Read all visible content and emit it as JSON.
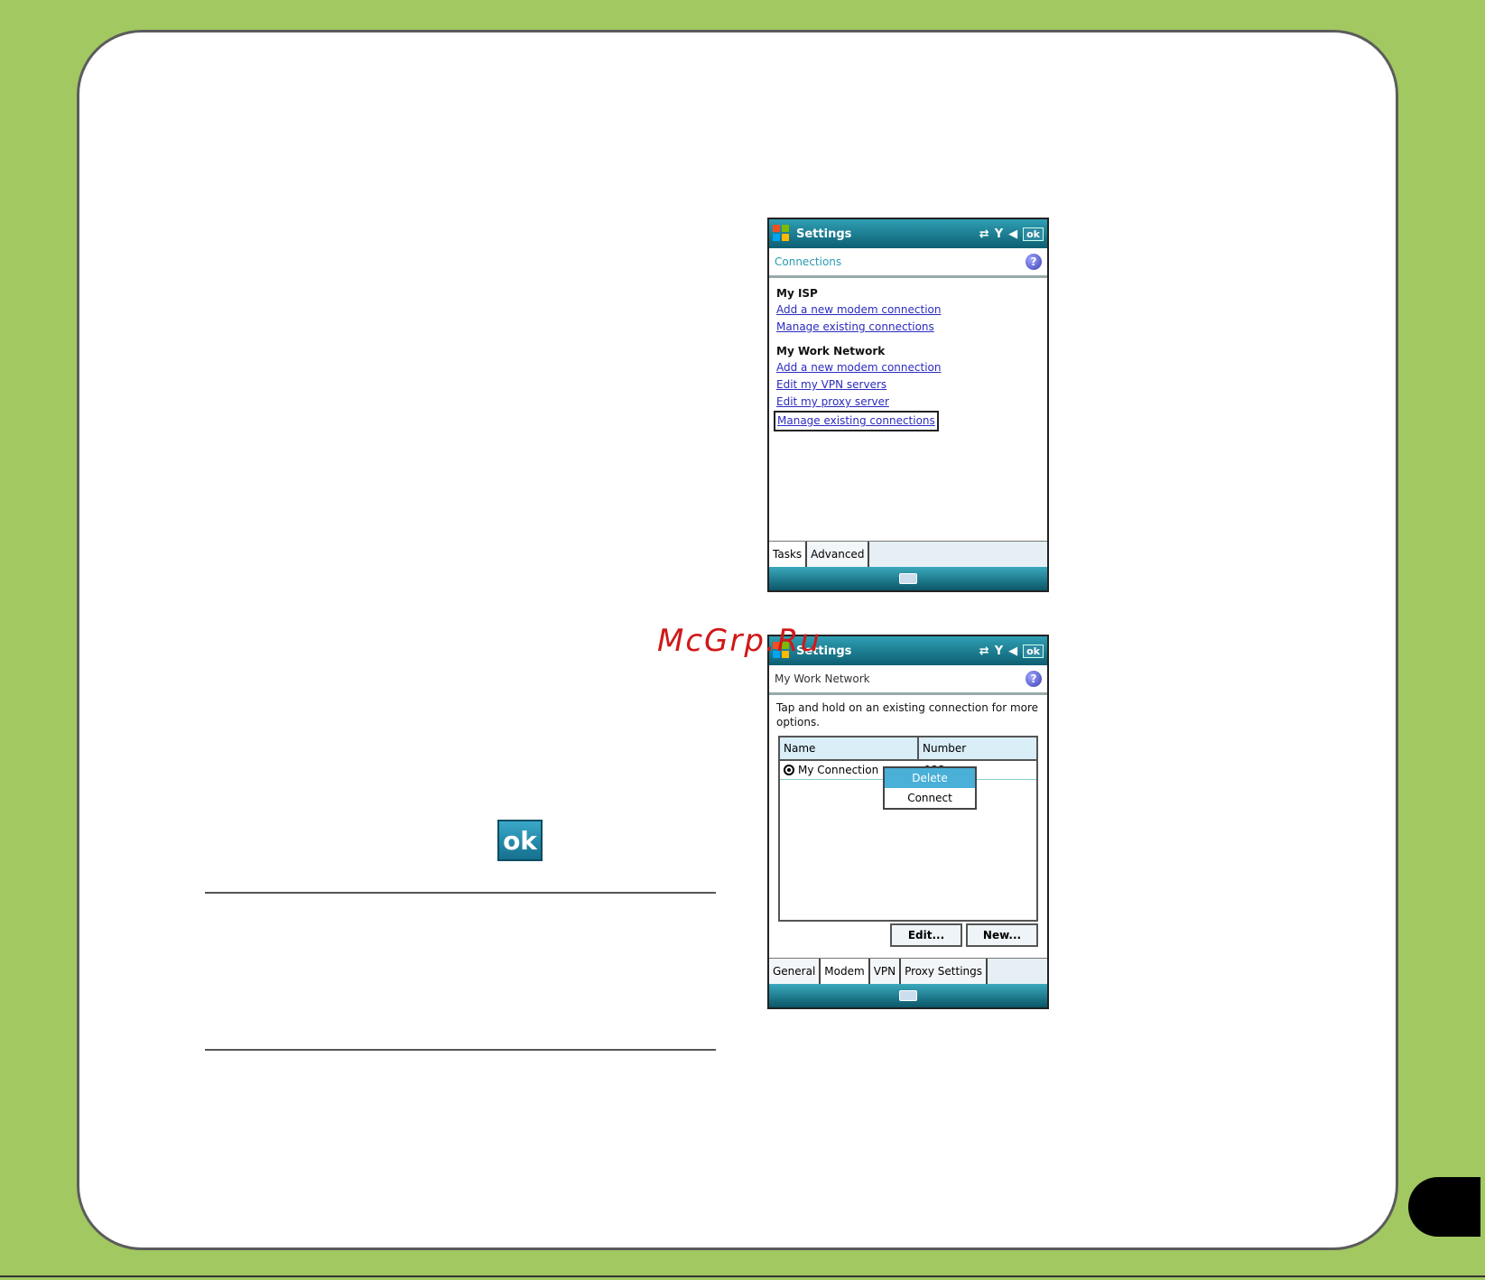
{
  "watermark": "McGrp.Ru",
  "ok_icon_label": "ok",
  "screen1": {
    "title": "Settings",
    "header": "Connections",
    "ok": "ok",
    "groups": [
      {
        "title": "My ISP",
        "links": [
          "Add a new modem connection",
          "Manage existing connections"
        ]
      },
      {
        "title": "My Work Network",
        "links": [
          "Add a new modem connection",
          "Edit my VPN servers",
          "Edit my proxy server",
          "Manage existing connections"
        ]
      }
    ],
    "tabs": [
      "Tasks",
      "Advanced"
    ]
  },
  "screen2": {
    "title": "Settings",
    "header": "My Work Network",
    "ok": "ok",
    "description": "Tap and hold on an existing connection for more options.",
    "columns": [
      "Name",
      "Number"
    ],
    "row": {
      "name": "My Connection",
      "number": "123"
    },
    "context_menu": [
      "Delete",
      "Connect"
    ],
    "buttons": {
      "edit": "Edit...",
      "new": "New..."
    },
    "tabs": [
      "General",
      "Modem",
      "VPN",
      "Proxy Settings"
    ]
  }
}
